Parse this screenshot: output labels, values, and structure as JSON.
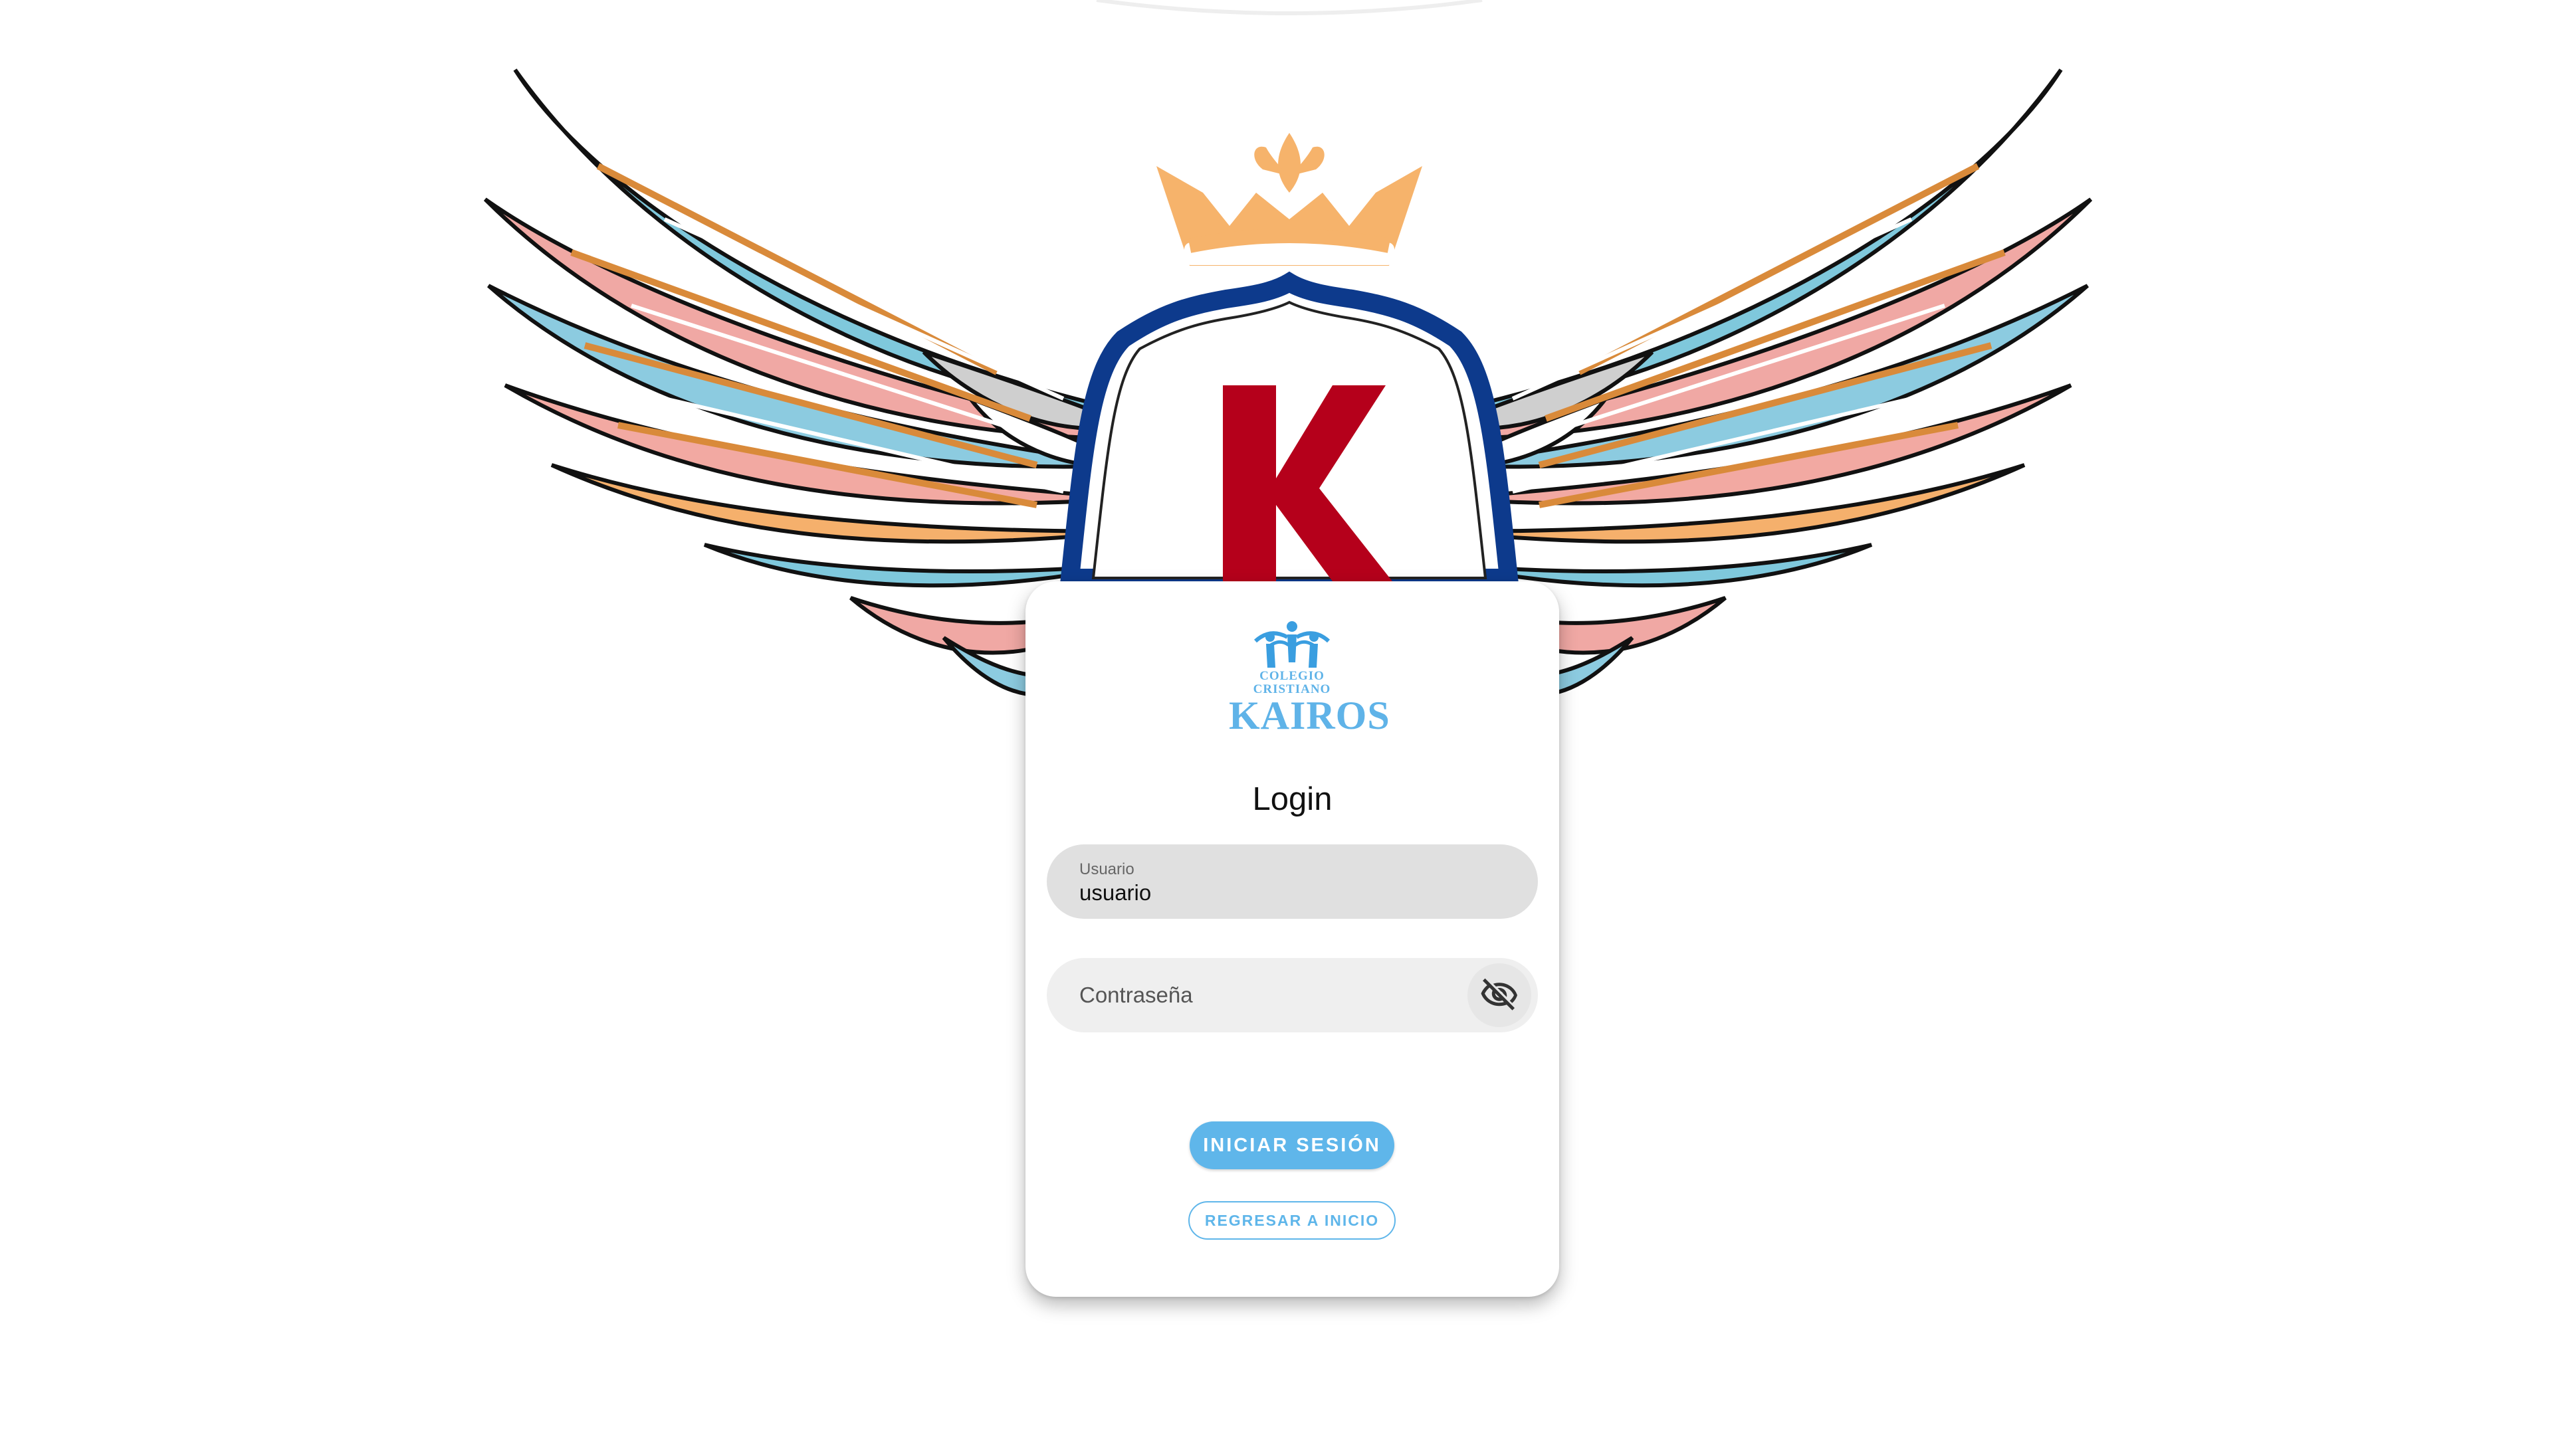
{
  "emblem": {
    "letter": "K",
    "icon": "winged-shield-crown-emblem"
  },
  "logo": {
    "line1": "COLEGIO",
    "line2": "CRISTIANO",
    "line3": "KAIROS",
    "icon": "family-figures-icon"
  },
  "login": {
    "title": "Login",
    "username": {
      "label": "Usuario",
      "value": "usuario"
    },
    "password": {
      "placeholder": "Contraseña",
      "toggle_icon": "eye-off-icon"
    },
    "submit_label": "INICIAR SESIÓN",
    "back_label": "REGRESAR A INICIO"
  },
  "colors": {
    "accent": "#5fb6ea",
    "crest_red": "#b5001b",
    "crest_blue": "#0d3a8c",
    "crown": "#f6b36b"
  }
}
